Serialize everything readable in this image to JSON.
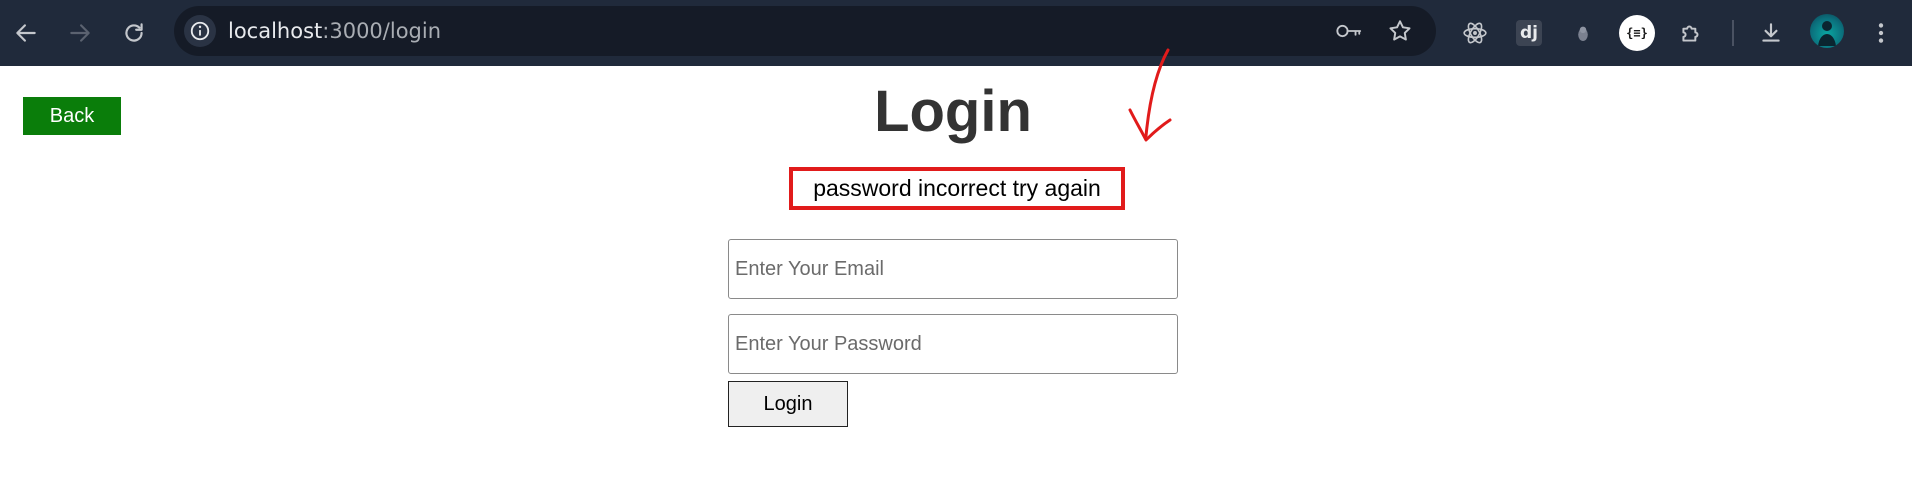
{
  "browser": {
    "url_host": "localhost",
    "url_rest": ":3000/login",
    "colors": {
      "toolbar": "#202a3b",
      "urlbar": "#151b27"
    },
    "icons": [
      "back-icon",
      "forward-icon",
      "reload-icon",
      "site-info-icon",
      "password-key-icon",
      "bookmark-star-icon",
      "react-devtools-icon",
      "django-icon",
      "extension-icon",
      "json-viewer-icon",
      "puzzle-extensions-icon",
      "download-icon",
      "avatar",
      "more-menu-icon"
    ],
    "ext_dj_label": "dj",
    "ext_json_label": "{≡}"
  },
  "page": {
    "back_label": "Back",
    "title": "Login",
    "error_message": "password incorrect try again",
    "email_placeholder": "Enter Your Email",
    "password_placeholder": "Enter Your Password",
    "login_button_label": "Login",
    "colors": {
      "back_button": "#0a7d0a",
      "error_border": "#e11b1b",
      "annotation_arrow": "#e11b1b"
    }
  }
}
